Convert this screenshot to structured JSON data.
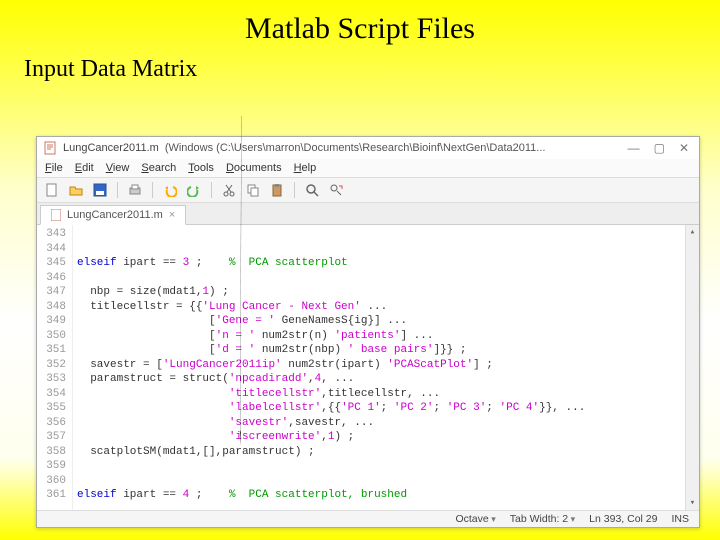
{
  "slide": {
    "title": "Matlab Script Files",
    "subtitle": "Input Data Matrix"
  },
  "titlebar": {
    "filename": "LungCancer2011.m",
    "path": "(Windows (C:\\Users\\marron\\Documents\\Research\\Bioinf\\NextGen\\Data2011...",
    "min": "—",
    "max": "▢",
    "close": "✕"
  },
  "menu": {
    "file": "File",
    "edit": "Edit",
    "view": "View",
    "search": "Search",
    "tools": "Tools",
    "documents": "Documents",
    "help": "Help"
  },
  "tab": {
    "label": "LungCancer2011.m",
    "close": "×"
  },
  "gutter": "343\n344\n345\n346\n347\n348\n349\n350\n351\n352\n353\n354\n355\n356\n357\n358\n359\n360\n361",
  "code": {
    "l343": "",
    "l344": "",
    "l345a": "elseif",
    "l345b": " ipart == ",
    "l345c": "3",
    "l345d": " ;    ",
    "l345e": "%  PCA scatterplot",
    "l346": "",
    "l347a": "  nbp = size(mdat1,",
    "l347b": "1",
    "l347c": ") ;",
    "l348a": "  titlecellstr = {{",
    "l348b": "'Lung Cancer - Next Gen'",
    "l348c": " ...",
    "l349a": "                    [",
    "l349b": "'Gene = '",
    "l349c": " GeneNamesS{ig}] ...",
    "l350a": "                    [",
    "l350b": "'n = '",
    "l350c": " num2str(n) ",
    "l350d": "'patients'",
    "l350e": "] ...",
    "l351a": "                    [",
    "l351b": "'d = '",
    "l351c": " num2str(nbp) ",
    "l351d": "' base pairs'",
    "l351e": "]}} ;",
    "l352a": "  savestr = [",
    "l352b": "'LungCancer2011ip'",
    "l352c": " num2str(ipart) ",
    "l352d": "'PCAScatPlot'",
    "l352e": "] ;",
    "l353a": "  paramstruct = struct(",
    "l353b": "'npcadiradd'",
    "l353c": ",",
    "l353d": "4",
    "l353e": ", ...",
    "l354a": "                       ",
    "l354b": "'titlecellstr'",
    "l354c": ",titlecellstr, ...",
    "l355a": "                       ",
    "l355b": "'labelcellstr'",
    "l355c": ",{{",
    "l355d": "'PC 1'",
    "l355e": "; ",
    "l355f": "'PC 2'",
    "l355g": "; ",
    "l355h": "'PC 3'",
    "l355i": "; ",
    "l355j": "'PC 4'",
    "l355k": "}}, ...",
    "l356a": "                       ",
    "l356b": "'savestr'",
    "l356c": ",savestr, ...",
    "l357a": "                       ",
    "l357b": "'iscreenwrite'",
    "l357c": ",",
    "l357d": "1",
    "l357e": ") ;",
    "l358": "  scatplotSM(mdat1,[],paramstruct) ;",
    "l359": "",
    "l360": "",
    "l361a": "elseif",
    "l361b": " ipart == ",
    "l361c": "4",
    "l361d": " ;    ",
    "l361e": "%  PCA scatterplot, brushed"
  },
  "status": {
    "lang": "Octave",
    "tabwidth_label": "Tab Width:",
    "tabwidth_value": "2",
    "pos": "Ln 393, Col 29",
    "mode": "INS"
  }
}
